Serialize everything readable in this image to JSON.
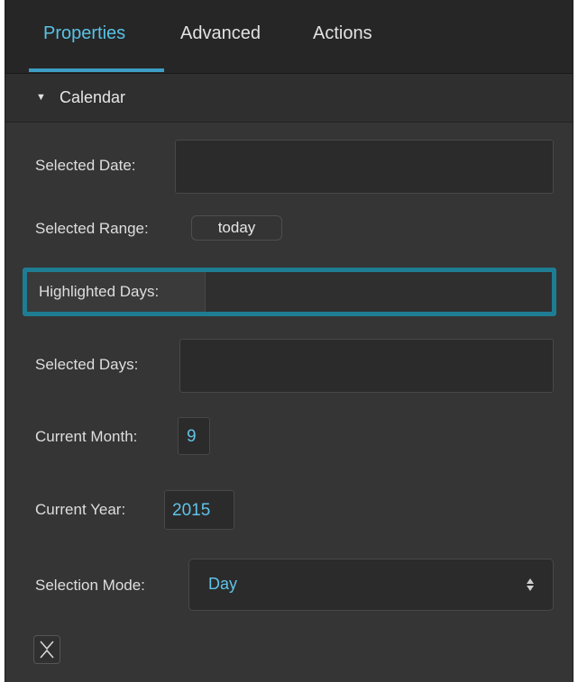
{
  "tabs": [
    {
      "label": "Properties",
      "active": true
    },
    {
      "label": "Advanced",
      "active": false
    },
    {
      "label": "Actions",
      "active": false
    }
  ],
  "section": {
    "arrow": "▼",
    "title": "Calendar"
  },
  "properties": {
    "selected_date": {
      "label": "Selected Date:",
      "value": ""
    },
    "selected_range": {
      "label": "Selected Range:",
      "value": "today"
    },
    "highlighted_days": {
      "label": "Highlighted Days:",
      "value": ""
    },
    "selected_days": {
      "label": "Selected Days:",
      "value": ""
    },
    "current_month": {
      "label": "Current Month:",
      "value": "9"
    },
    "current_year": {
      "label": "Current Year:",
      "value": "2015"
    },
    "selection_mode": {
      "label": "Selection Mode:",
      "value": "Day",
      "icon": "up-down-arrows-icon"
    }
  },
  "footer": {
    "collapse_icon": "collapse-icon"
  },
  "colors": {
    "accent": "#58c2e6",
    "highlight_border": "#1e7d93",
    "panel_bg": "#353535"
  }
}
